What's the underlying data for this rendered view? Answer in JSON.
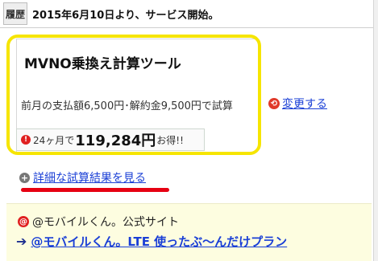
{
  "history": {
    "label": "履歴",
    "text": "2015年6月10日より、サービス開始。"
  },
  "calculator": {
    "title": "MVNO乗換え計算ツール",
    "description": "前月の支払額6,500円･解約金9,500円で試算",
    "change_link": "変更する",
    "savings": {
      "prefix": "24ヶ月で",
      "amount": "119,284円",
      "suffix": "お得!!"
    }
  },
  "details_link": "詳細な試算結果を見る",
  "site": {
    "name": "@モバイルくん。公式サイト",
    "link": "@モバイルくん。LTE 使ったぶ～んだけプラン"
  },
  "colors": {
    "highlight_box": "#f6e500",
    "underline_mark": "#e60012",
    "link": "#1a3fd6",
    "site_panel_bg": "#fdfde0"
  },
  "icons": {
    "change": "refresh-icon",
    "savings": "alert-icon",
    "details": "plus-circle-icon",
    "site": "at-sign-icon",
    "link": "arrow-right-icon"
  }
}
